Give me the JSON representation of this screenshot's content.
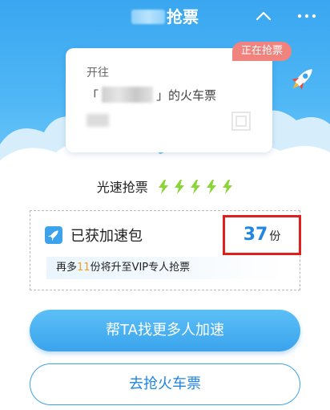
{
  "header": {
    "title": "抢票",
    "icons": [
      "share-icon",
      "more-icon"
    ]
  },
  "ticket": {
    "line1": "开往",
    "line2_open": "「",
    "line2_close": "」的火车票",
    "status_badge": "正在抢票"
  },
  "speed": {
    "label": "光速抢票",
    "bolts": 5
  },
  "boost": {
    "label": "已获加速包",
    "count": "37",
    "unit": "份",
    "vip_prefix": "再多",
    "vip_number": "11",
    "vip_suffix": "份将升至VIP专人抢票"
  },
  "buttons": {
    "primary": "帮TA找更多人加速",
    "secondary": "去抢火车票"
  },
  "colors": {
    "primary_blue": "#3aa3ec",
    "badge": "#f0837e",
    "highlight_box": "#e0201f",
    "count_blue": "#1f86e3",
    "vip_orange": "#f0a020"
  }
}
